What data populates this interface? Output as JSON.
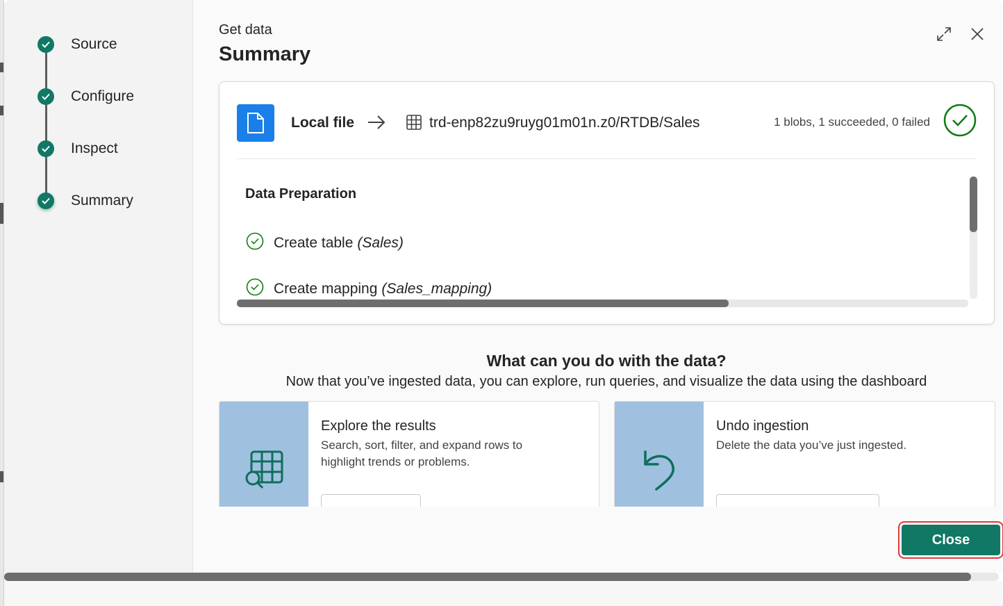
{
  "stepper": {
    "steps": [
      {
        "label": "Source",
        "status": "complete"
      },
      {
        "label": "Configure",
        "status": "complete"
      },
      {
        "label": "Inspect",
        "status": "complete"
      },
      {
        "label": "Summary",
        "status": "current"
      }
    ]
  },
  "header": {
    "breadcrumb": "Get data",
    "title": "Summary",
    "expand_icon": "expand-icon",
    "close_icon": "close-icon"
  },
  "summary_card": {
    "source_label": "Local file",
    "destination": "trd-enp82zu9ruyg01m01n.z0/RTDB/Sales",
    "counts": "1 blobs, 1 succeeded, 0 failed",
    "data_preparation": {
      "title": "Data Preparation",
      "items": [
        {
          "text": "Create table",
          "detail": "(Sales)"
        },
        {
          "text": "Create mapping",
          "detail": "(Sales_mapping)"
        }
      ]
    }
  },
  "next_steps": {
    "title": "What can you do with the data?",
    "subtitle": "Now that you’ve ingested data, you can explore, run queries, and visualize the data using the dashboard",
    "tiles": [
      {
        "title": "Explore the results",
        "description": "Search, sort, filter, and expand rows to highlight trends or problems.",
        "icon": "table-search-icon"
      },
      {
        "title": "Undo ingestion",
        "description": "Delete the data you’ve just ingested.",
        "icon": "undo-icon"
      }
    ]
  },
  "footer": {
    "close_label": "Close"
  },
  "colors": {
    "accent": "#117865",
    "file_tile": "#1a7fe8",
    "tile_art": "#9fc1df",
    "success": "#107c10"
  }
}
